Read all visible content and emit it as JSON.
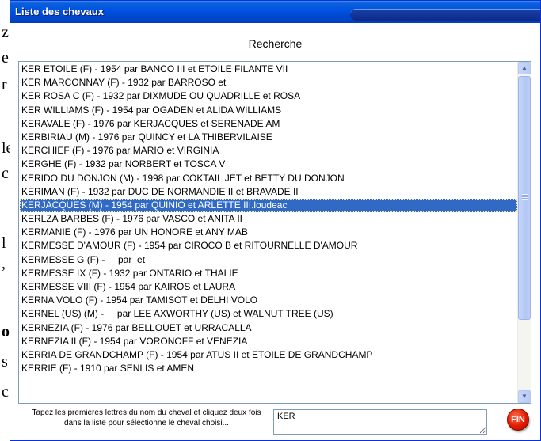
{
  "window": {
    "title": "Liste des chevaux"
  },
  "background_fragments": [
    "z",
    "e",
    "r",
    "le",
    "c",
    "l",
    ",",
    "or",
    "s",
    "c"
  ],
  "heading": "Recherche",
  "list": {
    "items": [
      "KER ETOILE (F) - 1954 par BANCO III et ETOILE FILANTE VII",
      "KER MARCONNAY (F) - 1932 par BARROSO et",
      "KER ROSA C (F) - 1932 par DIXMUDE OU QUADRILLE et ROSA",
      "KER WILLIAMS (F) - 1954 par OGADEN et ALIDA WILLIAMS",
      "KERAVALE (F) - 1976 par KERJACQUES et SERENADE AM",
      "KERBIRIAU (M) - 1976 par QUINCY et LA THIBERVILAISE",
      "KERCHIEF (F) - 1976 par MARIO et VIRGINIA",
      "KERGHE (F) - 1932 par NORBERT et TOSCA V",
      "KERIDO DU DONJON (M) - 1998 par COKTAIL JET et BETTY DU DONJON",
      "KERIMAN (F) - 1932 par DUC DE NORMANDIE II et BRAVADE II",
      "KERJACQUES (M) - 1954 par QUINIO et ARLETTE III.loudeac",
      "KERLZA BARBES (F) - 1976 par VASCO et ANITA II",
      "KERMANIE (F) - 1976 par UN HONORE et ANY MAB",
      "KERMESSE D'AMOUR (F) - 1954 par CIROCO B et RITOURNELLE D'AMOUR",
      "KERMESSE G (F) -     par  et",
      "KERMESSE IX (F) - 1932 par ONTARIO et THALIE",
      "KERMESSE VIII (F) - 1954 par KAIROS et LAURA",
      "KERNA VOLO (F) - 1954 par TAMISOT et DELHI VOLO",
      "KERNEL (US) (M) -     par LEE AXWORTHY (US) et WALNUT TREE (US)",
      "KERNEZIA (F) - 1976 par BELLOUET et URRACALLA",
      "KERNEZIA II (F) - 1954 par VORONOFF et VENEZIA",
      "KERRIA DE GRANDCHAMP (F) - 1954 par ATUS II et ETOILE DE GRANDCHAMP",
      "KERRIE (F) - 1910 par SENLIS et AMEN"
    ],
    "selected_index": 10
  },
  "scrollbar": {
    "up_icon": "arrow-up-icon",
    "down_icon": "arrow-down-icon"
  },
  "instructions": "Tapez les premières lettres du nom du cheval et cliquez deux fois dans la liste pour sélectionne le cheval choisi...",
  "search": {
    "value": "KER"
  },
  "fin_button": {
    "label": "FIN",
    "color": "#e01b00"
  }
}
